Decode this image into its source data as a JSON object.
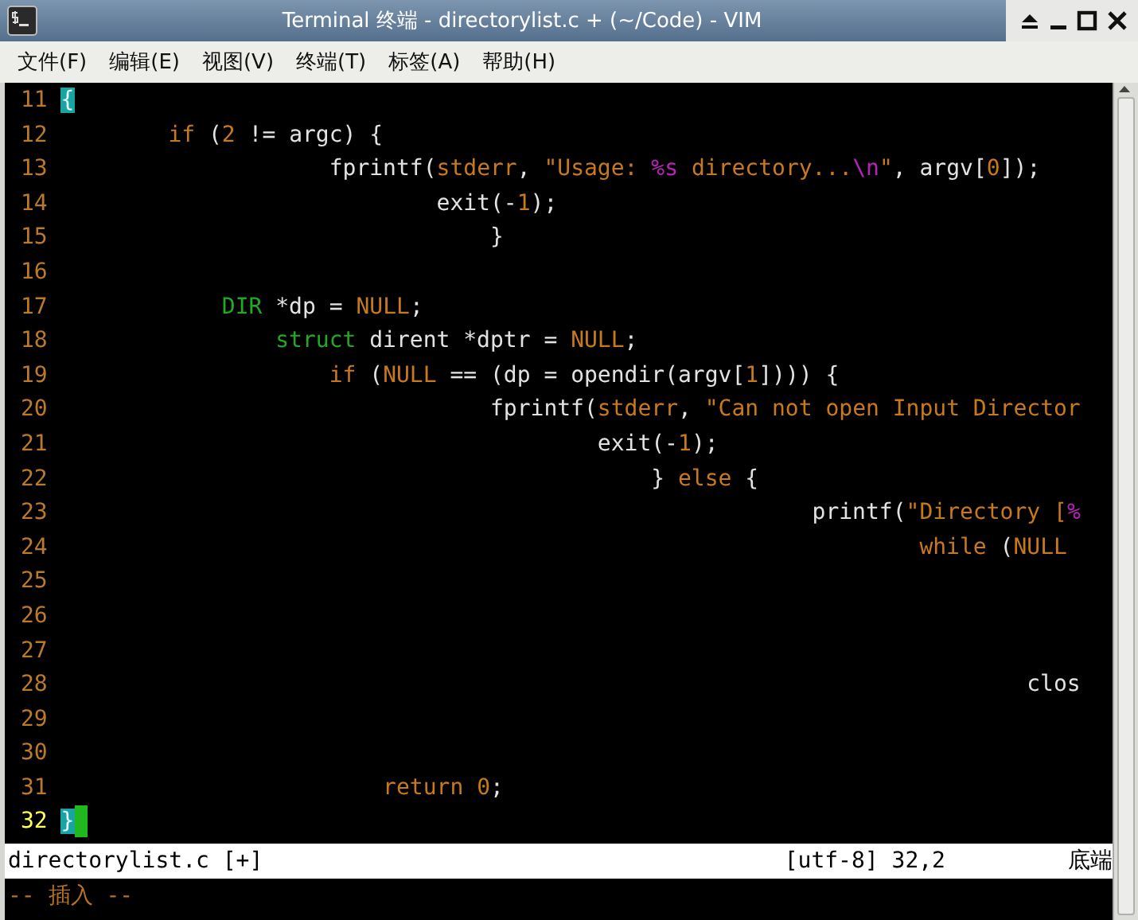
{
  "window": {
    "title": "Terminal 终端 - directorylist.c + (~/Code) - VIM"
  },
  "menu": [
    {
      "label": "文件(F)"
    },
    {
      "label": "编辑(E)"
    },
    {
      "label": "视图(V)"
    },
    {
      "label": "终端(T)"
    },
    {
      "label": "标签(A)"
    },
    {
      "label": "帮助(H)"
    }
  ],
  "editor": {
    "lines": [
      {
        "number": "11",
        "current": false,
        "segments": [
          {
            "kind": "match",
            "text": "{"
          }
        ]
      },
      {
        "number": "12",
        "current": false,
        "segments": [
          {
            "kind": "statement",
            "text": "        if"
          },
          {
            "kind": "plain",
            "text": " ("
          },
          {
            "kind": "constant",
            "text": "2"
          },
          {
            "kind": "plain",
            "text": " != argc) {"
          }
        ]
      },
      {
        "number": "13",
        "current": false,
        "segments": [
          {
            "kind": "plain",
            "text": "                    fprintf("
          },
          {
            "kind": "constant",
            "text": "stderr"
          },
          {
            "kind": "plain",
            "text": ", "
          },
          {
            "kind": "constant",
            "text": "\"Usage: "
          },
          {
            "kind": "special",
            "text": "%s"
          },
          {
            "kind": "constant",
            "text": " directory..."
          },
          {
            "kind": "special",
            "text": "\\n"
          },
          {
            "kind": "constant",
            "text": "\""
          },
          {
            "kind": "plain",
            "text": ", argv["
          },
          {
            "kind": "constant",
            "text": "0"
          },
          {
            "kind": "plain",
            "text": "]);"
          }
        ]
      },
      {
        "number": "14",
        "current": false,
        "segments": [
          {
            "kind": "plain",
            "text": "                            exit(-"
          },
          {
            "kind": "constant",
            "text": "1"
          },
          {
            "kind": "plain",
            "text": ");"
          }
        ]
      },
      {
        "number": "15",
        "current": false,
        "segments": [
          {
            "kind": "plain",
            "text": "                                }"
          }
        ]
      },
      {
        "number": "16",
        "current": false
      },
      {
        "number": "17",
        "current": false,
        "segments": [
          {
            "kind": "type",
            "text": "            DIR"
          },
          {
            "kind": "plain",
            "text": " *dp = "
          },
          {
            "kind": "constant",
            "text": "NULL"
          },
          {
            "kind": "plain",
            "text": ";"
          }
        ]
      },
      {
        "number": "18",
        "current": false,
        "segments": [
          {
            "kind": "type",
            "text": "                struct"
          },
          {
            "kind": "plain",
            "text": " dirent *dptr = "
          },
          {
            "kind": "constant",
            "text": "NULL"
          },
          {
            "kind": "plain",
            "text": ";"
          }
        ]
      },
      {
        "number": "19",
        "current": false,
        "segments": [
          {
            "kind": "statement",
            "text": "                    if"
          },
          {
            "kind": "plain",
            "text": " ("
          },
          {
            "kind": "constant",
            "text": "NULL"
          },
          {
            "kind": "plain",
            "text": " == (dp = opendir(argv["
          },
          {
            "kind": "constant",
            "text": "1"
          },
          {
            "kind": "plain",
            "text": "]))) {"
          }
        ]
      },
      {
        "number": "20",
        "current": false,
        "segments": [
          {
            "kind": "plain",
            "text": "                                fprintf("
          },
          {
            "kind": "constant",
            "text": "stderr"
          },
          {
            "kind": "plain",
            "text": ", "
          },
          {
            "kind": "constant",
            "text": "\"Can not open Input Director"
          }
        ]
      },
      {
        "number": "21",
        "current": false,
        "segments": [
          {
            "kind": "plain",
            "text": "                                        exit(-"
          },
          {
            "kind": "constant",
            "text": "1"
          },
          {
            "kind": "plain",
            "text": ");"
          }
        ]
      },
      {
        "number": "22",
        "current": false,
        "segments": [
          {
            "kind": "plain",
            "text": "                                            } "
          },
          {
            "kind": "statement",
            "text": "else"
          },
          {
            "kind": "plain",
            "text": " {"
          }
        ]
      },
      {
        "number": "23",
        "current": false,
        "segments": [
          {
            "kind": "plain",
            "text": "                                                        printf("
          },
          {
            "kind": "constant",
            "text": "\"Directory ["
          },
          {
            "kind": "special",
            "text": "%"
          }
        ]
      },
      {
        "number": "24",
        "current": false,
        "segments": [
          {
            "kind": "statement",
            "text": "                                                                while"
          },
          {
            "kind": "plain",
            "text": " ("
          },
          {
            "kind": "constant",
            "text": "NULL"
          }
        ]
      },
      {
        "number": "25",
        "current": false
      },
      {
        "number": "26",
        "current": false
      },
      {
        "number": "27",
        "current": false
      },
      {
        "number": "28",
        "current": false,
        "segments": [
          {
            "kind": "plain",
            "text": "                                                                        clos"
          }
        ]
      },
      {
        "number": "29",
        "current": false
      },
      {
        "number": "30",
        "current": false
      },
      {
        "number": "31",
        "current": false,
        "segments": [
          {
            "kind": "statement",
            "text": "                        return"
          },
          {
            "kind": "constant",
            "text": " 0"
          },
          {
            "kind": "plain",
            "text": ";"
          }
        ]
      },
      {
        "number": "32",
        "current": true,
        "segments": [
          {
            "kind": "match",
            "text": "}"
          }
        ]
      }
    ],
    "status": {
      "file": "directorylist.c [+]",
      "position": "[utf-8] 32,2",
      "scroll": "底端"
    },
    "mode": "-- 插入 --"
  }
}
